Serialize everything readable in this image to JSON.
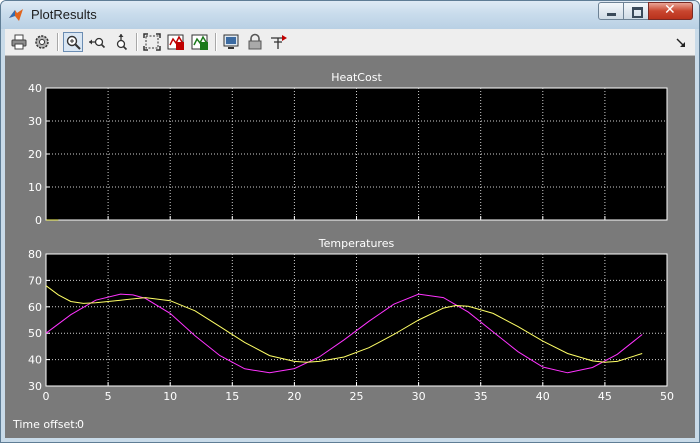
{
  "window": {
    "title": "PlotResults"
  },
  "toolbar": {
    "icons": [
      "print-icon",
      "parameters-icon",
      "zoom-icon",
      "zoom-x-icon",
      "zoom-y-icon",
      "autoscale-icon",
      "save-axes-icon",
      "restore-axes-icon",
      "floating-scope-icon",
      "lock-axes-icon",
      "signal-selection-icon"
    ],
    "active": "zoom-icon"
  },
  "footer": {
    "time_offset_label": "Time offset:",
    "time_offset_value": "0"
  },
  "colors": {
    "plot_bg": "#000000",
    "figure_bg": "#7a7a7a",
    "grid": "#cfcfcf",
    "magenta": "#ff33ff",
    "yellow": "#ffff66"
  },
  "chart_data": [
    {
      "type": "line",
      "title": "HeatCost",
      "xlim": [
        0,
        50
      ],
      "ylim": [
        0,
        40
      ],
      "xticks": [
        0,
        5,
        10,
        15,
        20,
        25,
        30,
        35,
        40,
        45,
        50
      ],
      "yticks": [
        0,
        10,
        20,
        30,
        40
      ],
      "grid": true,
      "show_xticklabels": false,
      "series": [
        {
          "color": "#ffff66",
          "x": [
            0,
            1
          ],
          "y": [
            0,
            0
          ]
        }
      ]
    },
    {
      "type": "line",
      "title": "Temperatures",
      "xlim": [
        0,
        50
      ],
      "ylim": [
        30,
        80
      ],
      "xticks": [
        0,
        5,
        10,
        15,
        20,
        25,
        30,
        35,
        40,
        45,
        50
      ],
      "yticks": [
        30,
        40,
        50,
        60,
        70,
        80
      ],
      "grid": true,
      "show_xticklabels": true,
      "series": [
        {
          "color": "#ff33ff",
          "x": [
            0,
            2,
            4,
            6,
            7,
            8,
            10,
            12,
            14,
            16,
            18,
            20,
            22,
            24,
            26,
            28,
            30,
            32,
            34,
            36,
            38,
            40,
            42,
            44,
            46,
            48
          ],
          "y": [
            50,
            57,
            62.5,
            64.8,
            64.5,
            63.2,
            57.5,
            49,
            41.5,
            36.5,
            35,
            36.6,
            41,
            47.5,
            54.5,
            61,
            64.8,
            63.5,
            58,
            50.5,
            43,
            37.2,
            35,
            37,
            42,
            49.5
          ]
        },
        {
          "color": "#ffff66",
          "x": [
            0,
            1,
            2,
            3,
            4,
            6,
            8,
            10,
            12,
            14,
            16,
            18,
            20,
            21,
            22,
            24,
            26,
            28,
            30,
            32,
            33,
            34,
            36,
            38,
            40,
            42,
            44,
            45,
            46,
            48
          ],
          "y": [
            68,
            64.5,
            62,
            61.3,
            61.5,
            62.5,
            63.5,
            62.3,
            58.5,
            52.5,
            46.5,
            41.5,
            39.3,
            39,
            39.3,
            41,
            44.5,
            49.5,
            55,
            59.5,
            60.5,
            60.2,
            57.5,
            52.5,
            47,
            42.3,
            39.5,
            39,
            39.3,
            42.3
          ]
        }
      ]
    }
  ]
}
